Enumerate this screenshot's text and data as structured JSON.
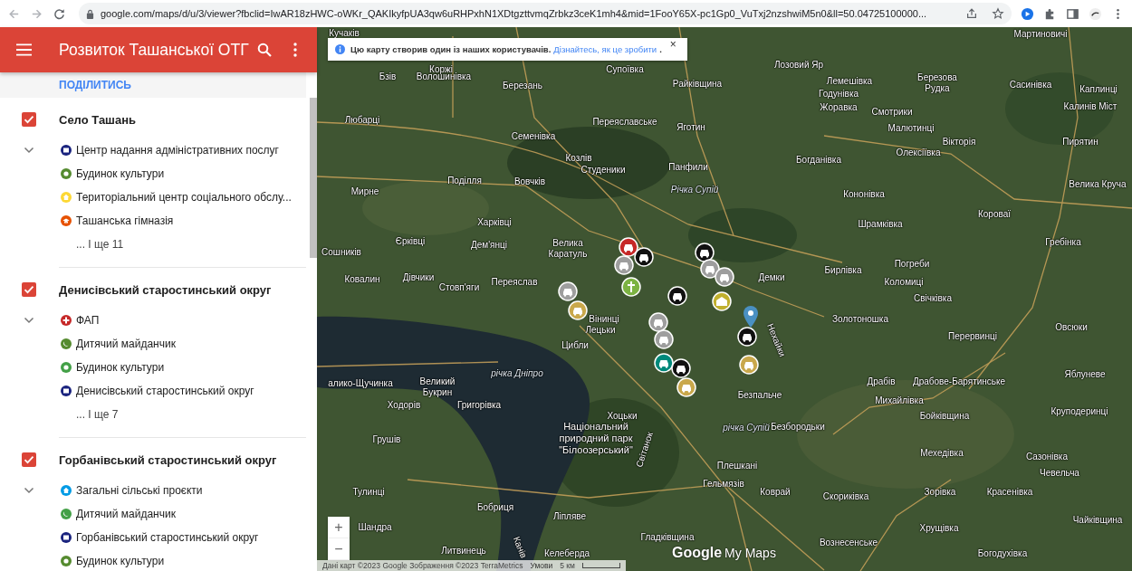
{
  "browser": {
    "url": "google.com/maps/d/u/3/viewer?fbclid=IwAR18zHWC-oWKr_QAKIkyfpUA3qw6uRHPxhN1XDtgzttvmqZrbkz3ceK1mh4&mid=1FooY65X-pc1Gp0_VuTxj2nzshwiM5n0&ll=50.04725100000..."
  },
  "sidebar": {
    "title": "Розвиток Ташанської ОТГ",
    "share": "ПОДІЛИТИСЬ",
    "layers": [
      {
        "title": "Село Ташань",
        "checked": true,
        "expanded": true,
        "items": [
          {
            "label": "Центр надання адміністративних послуг",
            "kind": "building",
            "color": "#1a237e"
          },
          {
            "label": "Будинок культури",
            "kind": "palette",
            "color": "#558b2f"
          },
          {
            "label": "Територіальний центр соціального обслу...",
            "kind": "home",
            "color": "#fdd835"
          },
          {
            "label": "Ташанська гімназія",
            "kind": "school",
            "color": "#e65100"
          }
        ],
        "more": "... І ще 11"
      },
      {
        "title": "Денисівський старостинський округ",
        "checked": true,
        "expanded": true,
        "items": [
          {
            "label": "ФАП",
            "kind": "cross",
            "color": "#c62828"
          },
          {
            "label": "Дитячий майданчик",
            "kind": "playground",
            "color": "#558b2f"
          },
          {
            "label": "Будинок культури",
            "kind": "palette",
            "color": "#43a047"
          },
          {
            "label": "Денисівський старостинський округ",
            "kind": "building",
            "color": "#1a237e"
          }
        ],
        "more": "... І ще 7"
      },
      {
        "title": "Горбанівський старостинський округ",
        "checked": true,
        "expanded": true,
        "items": [
          {
            "label": "Загальні сільські проєкти",
            "kind": "home",
            "color": "#039be5"
          },
          {
            "label": "Дитячий майданчик",
            "kind": "playground",
            "color": "#43a047"
          },
          {
            "label": "Горбанівський старостинський округ",
            "kind": "building",
            "color": "#1a237e"
          },
          {
            "label": "Будинок культури",
            "kind": "palette",
            "color": "#558b2f"
          }
        ]
      }
    ]
  },
  "map": {
    "notice": {
      "text": "Цю карту створив один із наших користувачів.",
      "link": "Дізнайтесь, як це зробити",
      "end": ".",
      "close": "×"
    },
    "labels": [
      {
        "text": "Кучаків",
        "kind": "place"
      },
      {
        "text": "Коржі",
        "kind": "place"
      },
      {
        "text": "Супоївка",
        "kind": "place"
      },
      {
        "text": "Бзів",
        "kind": "place"
      },
      {
        "text": "Волошинівка",
        "kind": "place"
      },
      {
        "text": "Березань",
        "kind": "place"
      },
      {
        "text": "Райківщина",
        "kind": "place"
      },
      {
        "text": "Любарці",
        "kind": "place"
      },
      {
        "text": "Переяславське",
        "kind": "place"
      },
      {
        "text": "Яготин",
        "kind": "place"
      },
      {
        "text": "Семенівка",
        "kind": "place"
      },
      {
        "text": "Козлів",
        "kind": "place"
      },
      {
        "text": "Студеники",
        "kind": "place"
      },
      {
        "text": "Панфили",
        "kind": "place"
      },
      {
        "text": "Мирне",
        "kind": "place"
      },
      {
        "text": "Поділля",
        "kind": "place"
      },
      {
        "text": "Вовчків",
        "kind": "place"
      },
      {
        "text": "Харківці",
        "kind": "place"
      },
      {
        "text": "Єрківці",
        "kind": "place"
      },
      {
        "text": "Дем'янці",
        "kind": "place"
      },
      {
        "text": "Сошників",
        "kind": "place"
      },
      {
        "text": "Велика Каратуль",
        "kind": "place2"
      },
      {
        "text": "Ковалин",
        "kind": "place"
      },
      {
        "text": "Дівчики",
        "kind": "place"
      },
      {
        "text": "Стовп'яги",
        "kind": "place"
      },
      {
        "text": "Переяслав",
        "kind": "place"
      },
      {
        "text": "Мартиновичі",
        "kind": "place"
      },
      {
        "text": "Лозовий Яр",
        "kind": "place"
      },
      {
        "text": "Лемешівка",
        "kind": "place"
      },
      {
        "text": "Годунівка",
        "kind": "place"
      },
      {
        "text": "Жоравка",
        "kind": "place"
      },
      {
        "text": "Березова Рудка",
        "kind": "place2"
      },
      {
        "text": "Сасинівка",
        "kind": "place"
      },
      {
        "text": "Смотрики",
        "kind": "place"
      },
      {
        "text": "Каплинці",
        "kind": "place"
      },
      {
        "text": "Калинів Міст",
        "kind": "place"
      },
      {
        "text": "Малютинці",
        "kind": "place"
      },
      {
        "text": "Вікторія",
        "kind": "place"
      },
      {
        "text": "Олексіївка",
        "kind": "place"
      },
      {
        "text": "Пирятин",
        "kind": "place"
      },
      {
        "text": "Богданівка",
        "kind": "place"
      },
      {
        "text": "Велика Круча",
        "kind": "place"
      },
      {
        "text": "Кононівка",
        "kind": "place"
      },
      {
        "text": "Короваї",
        "kind": "place"
      },
      {
        "text": "Шрамківка",
        "kind": "place"
      },
      {
        "text": "Гребінка",
        "kind": "place"
      },
      {
        "text": "Погреби",
        "kind": "place"
      },
      {
        "text": "Бирлівка",
        "kind": "place"
      },
      {
        "text": "Демки",
        "kind": "place"
      },
      {
        "text": "Коломиці",
        "kind": "place"
      },
      {
        "text": "Свічківка",
        "kind": "place"
      },
      {
        "text": "Вінинці",
        "kind": "place"
      },
      {
        "text": "Лецьки",
        "kind": "place"
      },
      {
        "text": "Цибли",
        "kind": "place"
      },
      {
        "text": "Золотоношка",
        "kind": "place"
      },
      {
        "text": "Перервинці",
        "kind": "place"
      },
      {
        "text": "Овсюки",
        "kind": "place"
      },
      {
        "text": "Нехайки",
        "kind": "place"
      },
      {
        "text": "річка Дніпро",
        "kind": "river"
      },
      {
        "text": "алико-Щучинка",
        "kind": "place"
      },
      {
        "text": "Великий Букрин",
        "kind": "place2"
      },
      {
        "text": "Драбів",
        "kind": "place"
      },
      {
        "text": "Драбове-Барятинське",
        "kind": "place"
      },
      {
        "text": "Яблуневе",
        "kind": "place"
      },
      {
        "text": "Ходорів",
        "kind": "place"
      },
      {
        "text": "Григорівка",
        "kind": "place"
      },
      {
        "text": "Безпальче",
        "kind": "place"
      },
      {
        "text": "Михайлівка",
        "kind": "place"
      },
      {
        "text": "Бойківщина",
        "kind": "place"
      },
      {
        "text": "Круподеринці",
        "kind": "place"
      },
      {
        "text": "Хоцьки",
        "kind": "place"
      },
      {
        "text": "Національний природний парк \"Білоозерський\"",
        "kind": "park"
      },
      {
        "text": "Безбородьки",
        "kind": "place"
      },
      {
        "text": "Грушів",
        "kind": "place"
      },
      {
        "text": "Світанок",
        "kind": "place"
      },
      {
        "text": "річка Супій",
        "kind": "river"
      },
      {
        "text": "Мехедівка",
        "kind": "place"
      },
      {
        "text": "Сазонівка",
        "kind": "place"
      },
      {
        "text": "Плешкані",
        "kind": "place"
      },
      {
        "text": "Чевельча",
        "kind": "place"
      },
      {
        "text": "Тулинці",
        "kind": "place"
      },
      {
        "text": "Гельмязів",
        "kind": "place"
      },
      {
        "text": "Коврай",
        "kind": "place"
      },
      {
        "text": "Скориківка",
        "kind": "place"
      },
      {
        "text": "Зорівка",
        "kind": "place"
      },
      {
        "text": "Красенівка",
        "kind": "place"
      },
      {
        "text": "Бобриця",
        "kind": "place"
      },
      {
        "text": "Ліпляве",
        "kind": "place"
      },
      {
        "text": "Шандра",
        "kind": "place"
      },
      {
        "text": "Хрущівка",
        "kind": "place"
      },
      {
        "text": "Чайківщина",
        "kind": "place"
      },
      {
        "text": "Гладківщина",
        "kind": "place"
      },
      {
        "text": "Вознесенське",
        "kind": "place"
      },
      {
        "text": "Литвинець",
        "kind": "place"
      },
      {
        "text": "Канів",
        "kind": "place"
      },
      {
        "text": "Келеберда",
        "kind": "place"
      },
      {
        "text": "Богодухівка",
        "kind": "place"
      },
      {
        "text": "Річка Супій",
        "kind": "river"
      }
    ],
    "markers": [
      {
        "kind": "car",
        "color": "#c62828"
      },
      {
        "kind": "car",
        "color": "#111111"
      },
      {
        "kind": "car",
        "color": "#9e9e9e"
      },
      {
        "kind": "car",
        "color": "#111111"
      },
      {
        "kind": "car",
        "color": "#9e9e9e"
      },
      {
        "kind": "car",
        "color": "#9e9e9e"
      },
      {
        "kind": "car",
        "color": "#9e9e9e"
      },
      {
        "kind": "car",
        "color": "#c9a84c"
      },
      {
        "kind": "cross",
        "color": "#7cb342"
      },
      {
        "kind": "car",
        "color": "#111111"
      },
      {
        "kind": "building",
        "color": "#c0b02e"
      },
      {
        "kind": "car",
        "color": "#9e9e9e"
      },
      {
        "kind": "car",
        "color": "#9e9e9e"
      },
      {
        "kind": "car",
        "color": "#111111"
      },
      {
        "kind": "car",
        "color": "#00897b"
      },
      {
        "kind": "car",
        "color": "#111111"
      },
      {
        "kind": "car",
        "color": "#c9a84c"
      },
      {
        "kind": "car",
        "color": "#c9a84c"
      },
      {
        "kind": "pin",
        "color": "#4a90c2"
      }
    ],
    "zoom": {
      "in": "+",
      "out": "−"
    },
    "logo": {
      "google": "Google",
      "product": "My Maps"
    },
    "attribution": {
      "text": "Дані карт ©2023 Google Зображення ©2023 TerraMetrics",
      "terms": "Умови",
      "scale": "5 км"
    }
  }
}
